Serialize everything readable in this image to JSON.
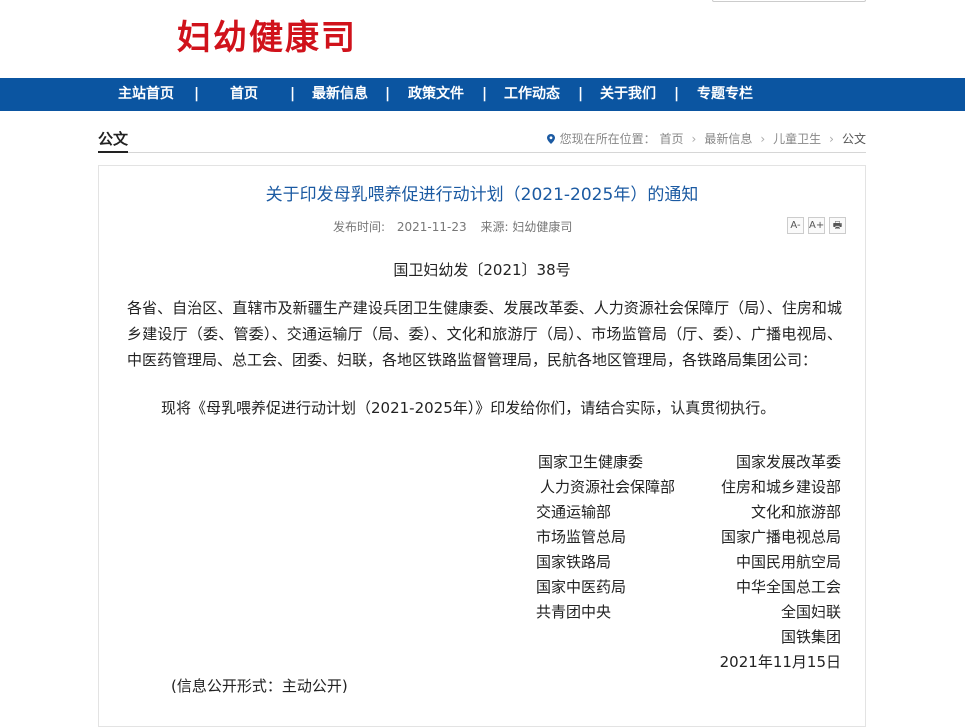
{
  "header": {
    "site_title": "妇幼健康司"
  },
  "nav": {
    "items": [
      "主站首页",
      "首页",
      "最新信息",
      "政策文件",
      "工作动态",
      "关于我们",
      "专题专栏"
    ],
    "separator": "|"
  },
  "section": {
    "title": "公文"
  },
  "breadcrumb": {
    "prefix": "您现在所在位置：",
    "items": [
      "首页",
      "最新信息",
      "儿童卫生"
    ],
    "current": "公文",
    "separator": "›"
  },
  "article": {
    "title": "关于印发母乳喂养促进行动计划（2021-2025年）的通知",
    "publish_label": "发布时间:",
    "publish_date": "2021-11-23",
    "source_label": "来源:",
    "source": "妇幼健康司",
    "tools": [
      "A-",
      "A+",
      "🖶"
    ],
    "doc_number": "国卫妇幼发〔2021〕38号",
    "recipients": "各省、自治区、直辖市及新疆生产建设兵团卫生健康委、发展改革委、人力资源社会保障厅（局）、住房和城乡建设厅（委、管委）、交通运输厅（局、委）、文化和旅游厅（局）、市场监管局（厅、委）、广播电视局、中医药管理局、总工会、团委、妇联，各地区铁路监督管理局，民航各地区管理局，各铁路局集团公司：",
    "body": "现将《母乳喂养促进行动计划（2021-2025年）》印发给你们，请结合实际，认真贯彻执行。",
    "signatories_left": [
      "国家卫生健康委",
      "人力资源社会保障部",
      "交通运输部",
      "市场监管总局",
      "国家铁路局",
      "国家中医药局",
      "共青团中央"
    ],
    "signatories_right": [
      "国家发展改革委",
      "住房和城乡建设部",
      "文化和旅游部",
      "国家广播电视总局",
      "中国民用航空局",
      "中华全国总工会",
      "全国妇联",
      "国铁集团"
    ],
    "date": "2021年11月15日",
    "disclosure": "(信息公开形式：主动公开)"
  },
  "colors": {
    "brand_red": "#d0121b",
    "nav_blue": "#0b55a1",
    "title_blue": "#1b5aa2"
  }
}
